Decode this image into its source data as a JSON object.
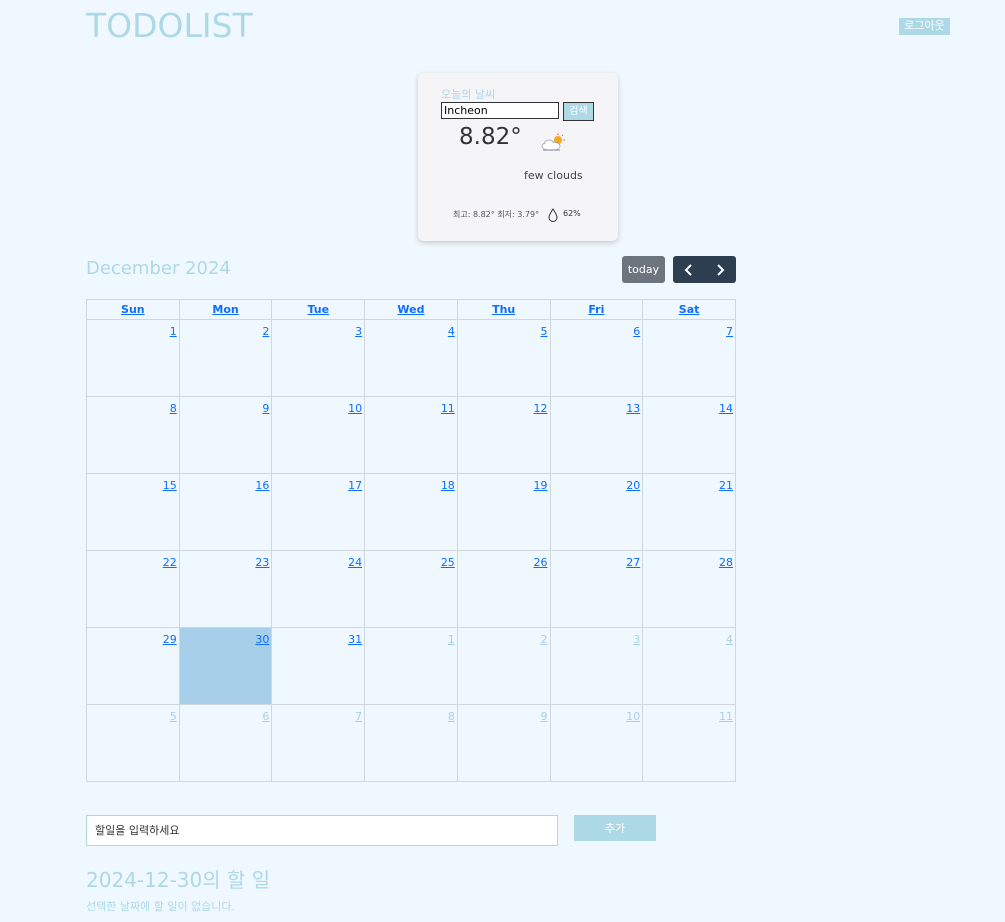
{
  "app": {
    "title": "TODOLIST",
    "logout_label": "로그아웃"
  },
  "weather": {
    "title": "오늘의 날씨",
    "city_value": "Incheon",
    "search_label": "검색",
    "temperature": "8.82°",
    "icon": "few-clouds-icon",
    "description": "few clouds",
    "minmax": "최고: 8.82° 최저: 3.79°",
    "humidity": "62%"
  },
  "calendar": {
    "month_title": "December 2024",
    "today_label": "today",
    "weekdays": [
      "Sun",
      "Mon",
      "Tue",
      "Wed",
      "Thu",
      "Fri",
      "Sat"
    ],
    "weeks": [
      [
        "1",
        "2",
        "3",
        "4",
        "5",
        "6",
        "7"
      ],
      [
        "8",
        "9",
        "10",
        "11",
        "12",
        "13",
        "14"
      ],
      [
        "15",
        "16",
        "17",
        "18",
        "19",
        "20",
        "21"
      ],
      [
        "22",
        "23",
        "24",
        "25",
        "26",
        "27",
        "28"
      ],
      [
        "29",
        "30",
        "31",
        "1",
        "2",
        "3",
        "4"
      ],
      [
        "5",
        "6",
        "7",
        "8",
        "9",
        "10",
        "11"
      ]
    ],
    "selected_day": "30"
  },
  "todo": {
    "input_placeholder": "할일을 입력하세요",
    "input_value": "",
    "add_label": "추가",
    "heading": "2024-12-30의 할 일",
    "empty_message": "선택한 날짜에 할 일이 없습니다."
  },
  "colors": {
    "accent": "#add8e6",
    "background": "#f0f8ff",
    "link": "#0d6efd",
    "selected": "#a8cfea",
    "nav_dark": "#2c3e50",
    "today_button": "#6c757d"
  }
}
